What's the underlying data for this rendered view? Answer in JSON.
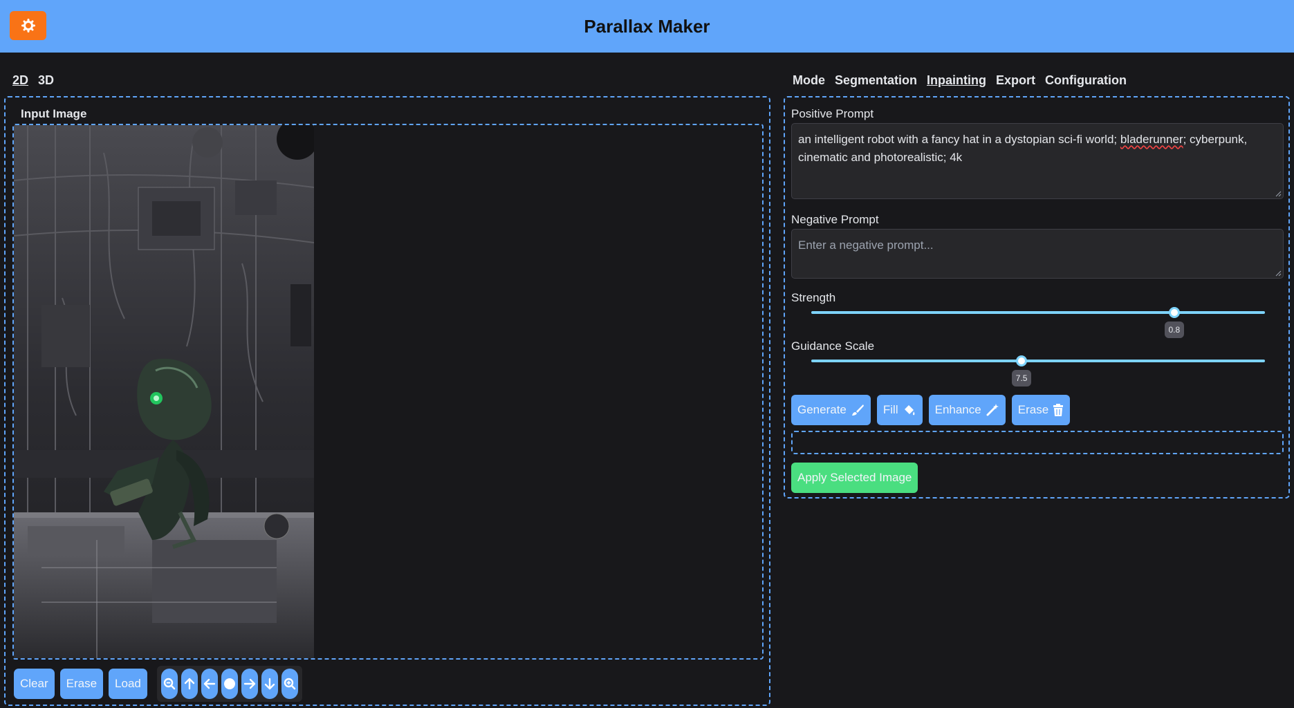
{
  "header": {
    "title": "Parallax Maker",
    "settings_icon": "gear-icon"
  },
  "left": {
    "tabs": [
      {
        "label": "2D",
        "active": true
      },
      {
        "label": "3D",
        "active": false
      }
    ],
    "panel_label": "Input Image",
    "tools": {
      "clear": "Clear",
      "erase": "Erase",
      "load": "Load"
    },
    "nav_icons": [
      "zoom-out-icon",
      "arrow-up-icon",
      "arrow-left-icon",
      "center-icon",
      "arrow-right-icon",
      "arrow-down-icon",
      "zoom-in-icon"
    ]
  },
  "right": {
    "tabs": [
      {
        "label": "Mode",
        "active": false
      },
      {
        "label": "Segmentation",
        "active": false
      },
      {
        "label": "Inpainting",
        "active": true
      },
      {
        "label": "Export",
        "active": false
      },
      {
        "label": "Configuration",
        "active": false
      }
    ],
    "positive_prompt": {
      "label": "Positive Prompt",
      "value_before": "an intelligent robot with a fancy hat in a dystopian sci-fi world; ",
      "value_misspelled": "bladerunner",
      "value_after": "; cyberpunk, cinematic and photorealistic; 4k"
    },
    "negative_prompt": {
      "label": "Negative Prompt",
      "placeholder": "Enter a negative prompt..."
    },
    "strength": {
      "label": "Strength",
      "value": "0.8",
      "fraction": 0.8
    },
    "guidance": {
      "label": "Guidance Scale",
      "value": "7.5",
      "fraction": 0.4636
    },
    "buttons": {
      "generate": "Generate",
      "fill": "Fill",
      "enhance": "Enhance",
      "erase": "Erase"
    },
    "apply": "Apply Selected Image"
  },
  "colors": {
    "accent": "#60a5fa",
    "settings": "#f97316",
    "apply": "#4ade80",
    "background": "#18181b"
  }
}
